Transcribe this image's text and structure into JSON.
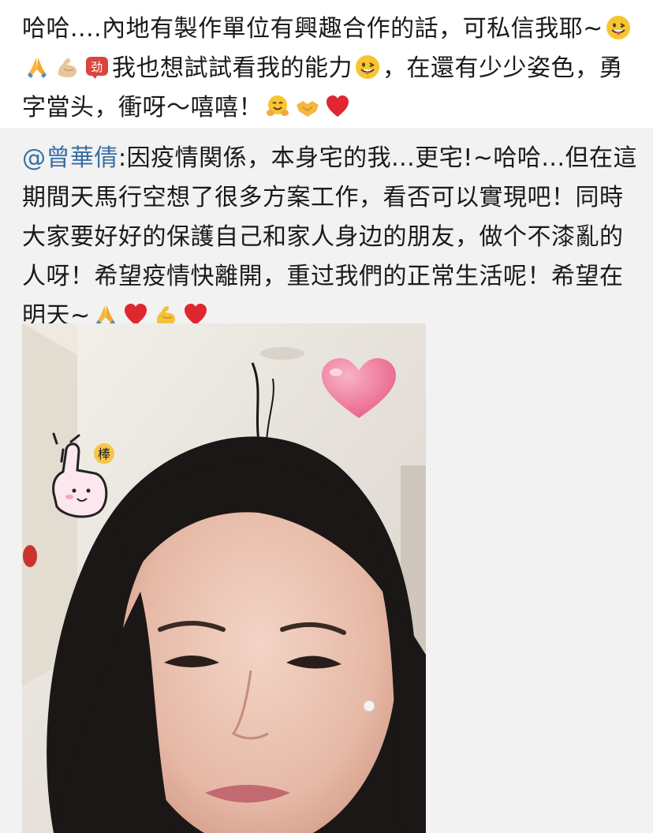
{
  "post": {
    "text_part1": "哈哈....內地有製作單位有興趣合作的話，可私信我耶~",
    "text_part2": "我也想試試看我的能力",
    "text_part3": "，在還有少少姿色，勇字當头，衝呀～嘻嘻！",
    "emojis": [
      "grinning-tongue-icon",
      "pray-icon",
      "muscle-icon",
      "jiayou-badge-icon",
      "grinning-tongue-icon",
      "hug-icon",
      "handshake-icon",
      "red-heart-icon"
    ]
  },
  "repost": {
    "mention": "@曾華倩",
    "text": ":因疫情関係，本身宅的我...更宅!~哈哈...但在這期間天馬行空想了很多方案工作，看否可以實現吧！同時大家要好好的保護自己和家人身边的朋友，做个不漆亂的人呀！希望疫情快離開，重过我們的正常生活呢！希望在明天~",
    "emojis": [
      "pray-icon",
      "red-heart-icon",
      "muscle-icon",
      "red-heart-icon"
    ]
  },
  "photo": {
    "sticker_text": "棒",
    "emoji_badge_text": "↻"
  }
}
